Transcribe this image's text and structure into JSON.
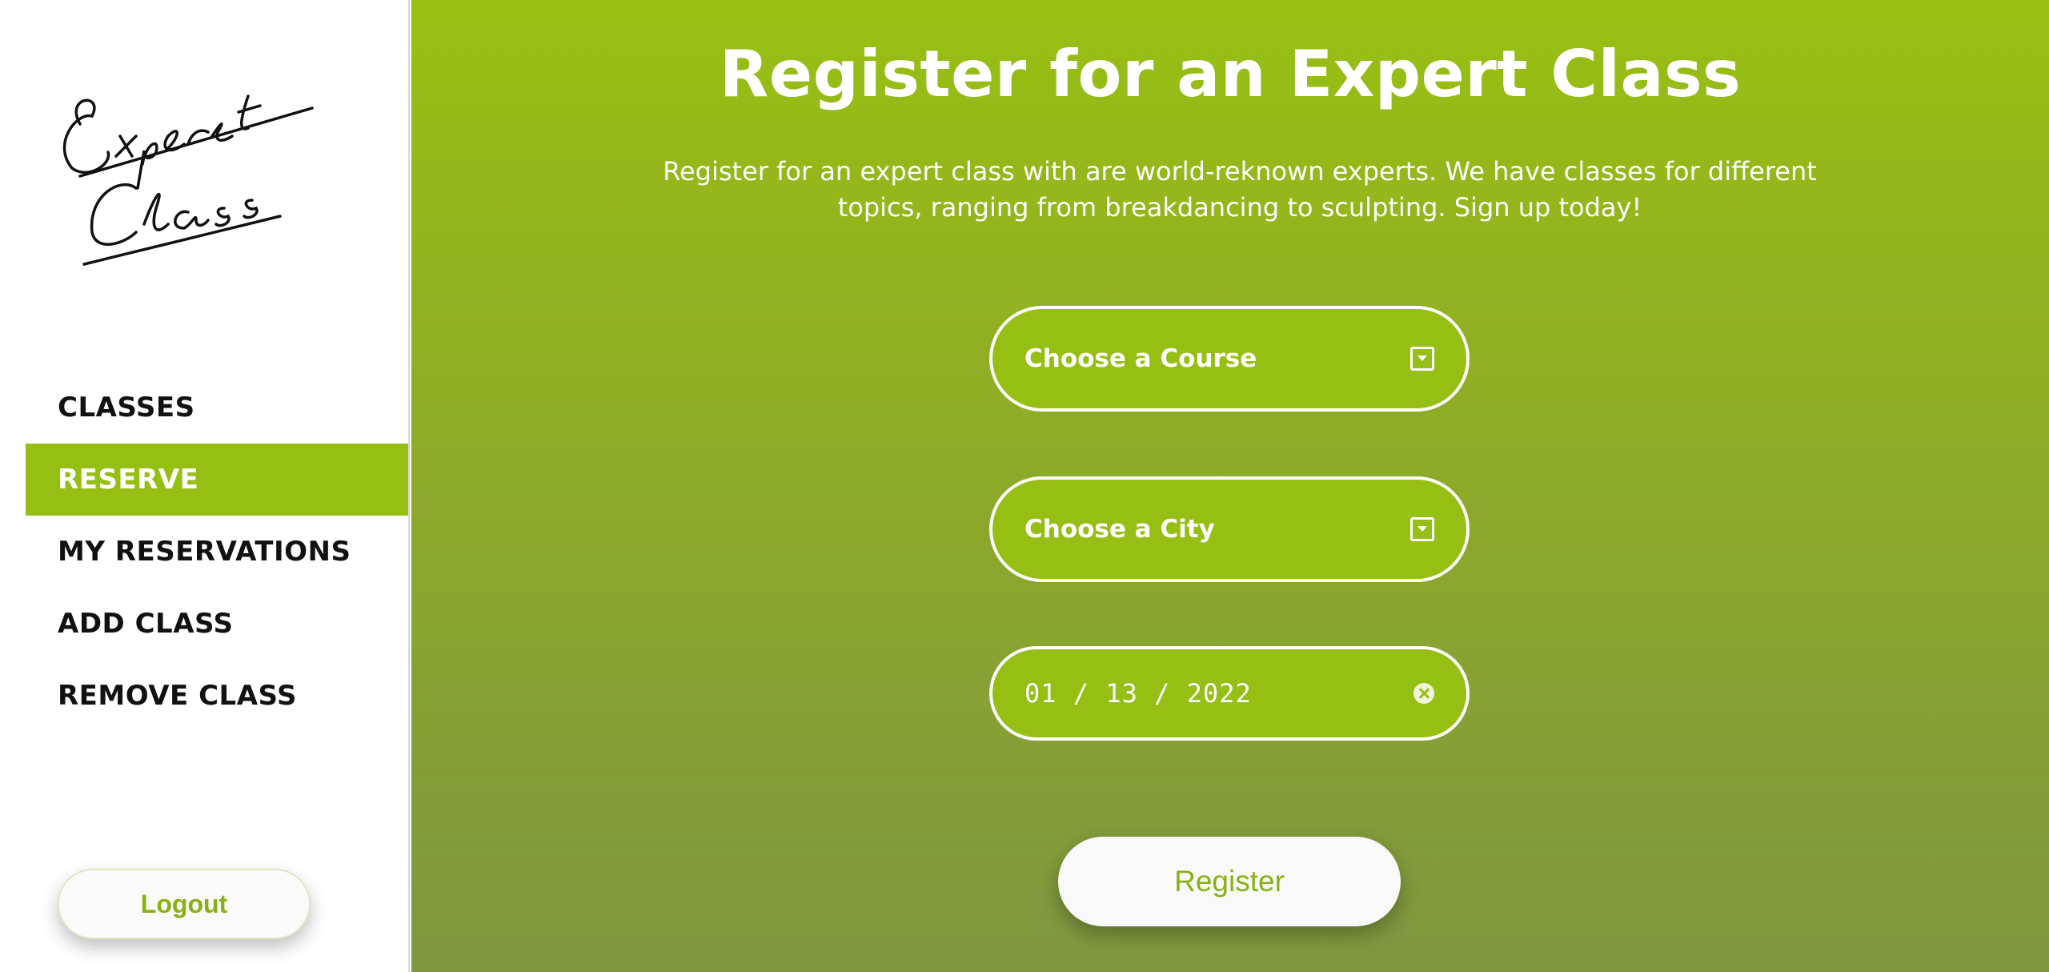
{
  "sidebar": {
    "logo_text": [
      "Expert",
      "Class"
    ],
    "items": [
      {
        "label": "CLASSES",
        "active": false
      },
      {
        "label": "RESERVE",
        "active": true
      },
      {
        "label": "MY RESERVATIONS",
        "active": false
      },
      {
        "label": "ADD CLASS",
        "active": false
      },
      {
        "label": "REMOVE CLASS",
        "active": false
      }
    ],
    "logout_label": "Logout"
  },
  "main": {
    "title": "Register for an Expert Class",
    "description": "Register for an expert class with are world-reknown experts. We have classes for different topics, ranging from breakdancing to sculpting. Sign up today!",
    "course_select": {
      "label": "Choose a Course",
      "icon": "dropdown-icon"
    },
    "city_select": {
      "label": "Choose a City",
      "icon": "dropdown-icon"
    },
    "date_input": {
      "value": "01 / 13 / 2022",
      "icon": "clear-icon"
    },
    "register_label": "Register"
  },
  "colors": {
    "accent": "#96bf13",
    "gradient_bottom": "#7f9640",
    "button_text": "#87b115"
  }
}
